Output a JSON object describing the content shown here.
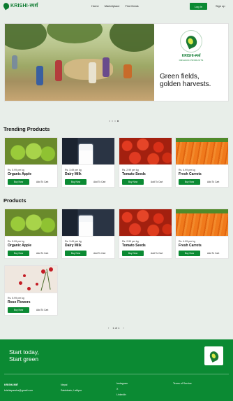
{
  "nav": {
    "brand": "KRISHI-स्पर्श",
    "links": [
      "Home",
      "Marketplace",
      "Find Deals"
    ],
    "login": "Log In",
    "signup": "Sign up"
  },
  "hero": {
    "brand_name": "KRISHI-स्पर्श",
    "brand_sub": "ORGANIC PRODUCTS",
    "tagline_line1": "Green fields,",
    "tagline_line2": "golden harvests."
  },
  "trending": {
    "title": "Trending Products",
    "items": [
      {
        "price": "Rs. 5.99 per kg",
        "name": "Organic Apple",
        "buy": "Buy Now",
        "add": "Add To Cart"
      },
      {
        "price": "Rs. 3.49 per kg",
        "name": "Dairy Milk",
        "buy": "Buy Now",
        "add": "Add To Cart"
      },
      {
        "price": "Rs. 2.99 per kg",
        "name": "Tomato Seeds",
        "buy": "Buy Now",
        "add": "Add To Cart"
      },
      {
        "price": "Rs. 4.99 per kg",
        "name": "Fresh Carrots",
        "buy": "Buy Now",
        "add": "Add To Cart"
      }
    ]
  },
  "products": {
    "title": "Products",
    "items": [
      {
        "price": "Rs. 5.99 per kg",
        "name": "Organic Apple",
        "buy": "Buy Now",
        "add": "Add To Cart"
      },
      {
        "price": "Rs. 3.49 per kg",
        "name": "Dairy Milk",
        "buy": "Buy Now",
        "add": "Add To Cart"
      },
      {
        "price": "Rs. 2.99 per kg",
        "name": "Tomato Seeds",
        "buy": "Buy Now",
        "add": "Add To Cart"
      },
      {
        "price": "Rs. 4.99 per kg",
        "name": "Fresh Carrots",
        "buy": "Buy Now",
        "add": "Add To Cart"
      },
      {
        "price": "Rs. 5.99 per kg",
        "name": "Rose Flowers",
        "buy": "Buy Now",
        "add": "Add To Cart"
      }
    ]
  },
  "pagination": {
    "prev": "‹",
    "label": "1 of 1",
    "next": "›"
  },
  "footer": {
    "cta_line1": "Start today,",
    "cta_line2": "Start green",
    "brand": "KRISHI-स्पर्श",
    "email": "krishisparsha@gmail.com",
    "country": "Nepal",
    "address": "Satdobato, Lalitpur",
    "social1": "Instagram",
    "social2": "X",
    "social3": "LinkedIn",
    "terms": "Terms of Service"
  },
  "colors": {
    "primary": "#0b8a33",
    "background": "#e8eee9"
  }
}
